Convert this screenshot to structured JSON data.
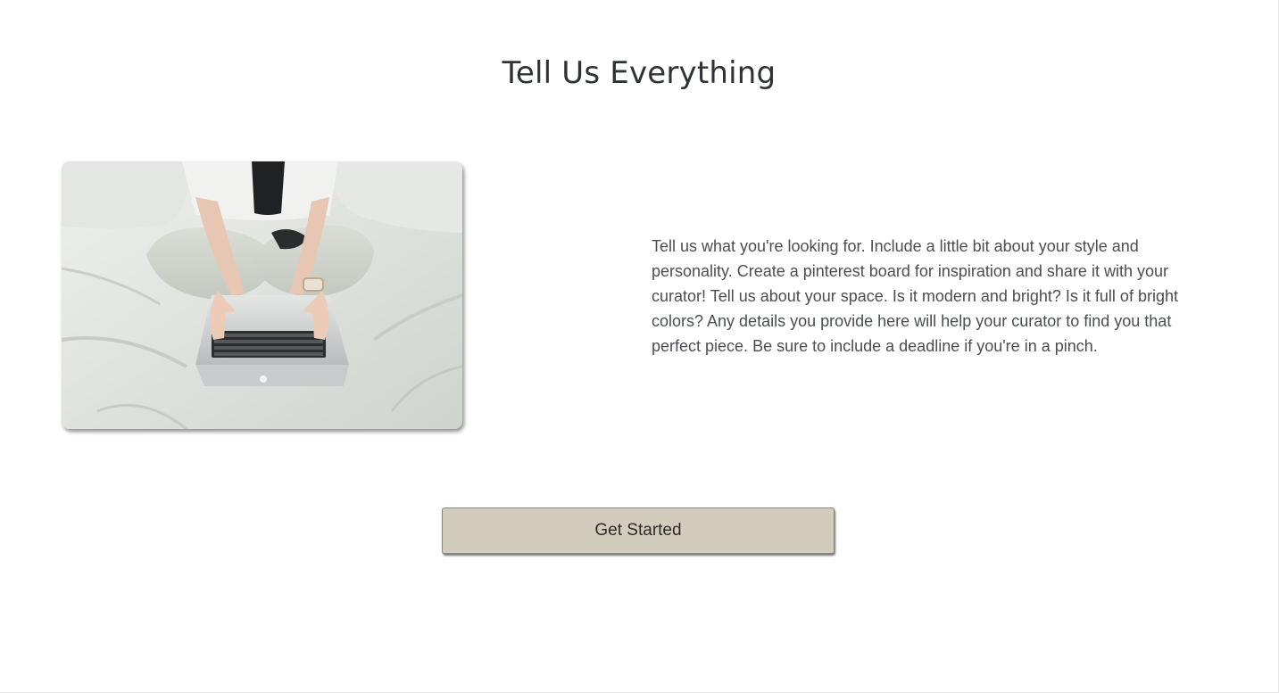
{
  "section": {
    "title": "Tell Us Everything",
    "description": "Tell us what you're looking for. Include a little bit about your style and personality. Create a pinterest board for inspiration and share it with your curator! Tell us about your space. Is it modern and bright? Is it full of bright colors? Any details you provide here will help your curator to find you that perfect piece. Be sure to include a deadline if you're in a pinch."
  },
  "image": {
    "subject": "person-typing-on-laptop-on-bed"
  },
  "cta": {
    "label": "Get Started"
  },
  "colors": {
    "button_bg": "#d2ccbd",
    "title_text": "#2f3336",
    "body_text": "#4a4e52"
  }
}
